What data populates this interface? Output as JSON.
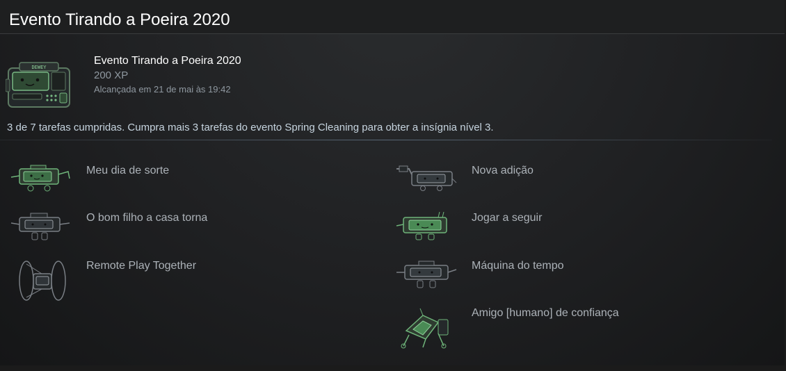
{
  "header": {
    "title": "Evento Tirando a Poeira 2020"
  },
  "badge": {
    "name": "Evento Tirando a Poeira 2020",
    "xp": "200 XP",
    "unlocked": "Alcançada em 21 de mai às 19:42",
    "icon": "robot-badge-icon",
    "icon_text": "DEWEY"
  },
  "progress_text": "3 de 7 tarefas cumpridas. Cumpra mais 3 tarefas do evento Spring Cleaning para obter a insígnia nível 3.",
  "colors": {
    "completed": "#6fb57a",
    "incomplete": "#7a7f85",
    "text": "#acb2b8"
  },
  "tasks_left": [
    {
      "label": "Meu dia de sorte",
      "completed": true,
      "icon": "robot-lucky-icon"
    },
    {
      "label": "O bom filho a casa torna",
      "completed": false,
      "icon": "robot-return-icon"
    },
    {
      "label": "Remote Play Together",
      "completed": false,
      "icon": "robot-remote-play-icon"
    }
  ],
  "tasks_right": [
    {
      "label": "Nova adição",
      "completed": false,
      "icon": "robot-new-addition-icon"
    },
    {
      "label": "Jogar a seguir",
      "completed": true,
      "icon": "robot-play-next-icon"
    },
    {
      "label": "Máquina do tempo",
      "completed": false,
      "icon": "robot-time-machine-icon"
    },
    {
      "label": "Amigo [humano] de confiança",
      "completed": true,
      "icon": "robot-trusted-friend-icon"
    }
  ]
}
